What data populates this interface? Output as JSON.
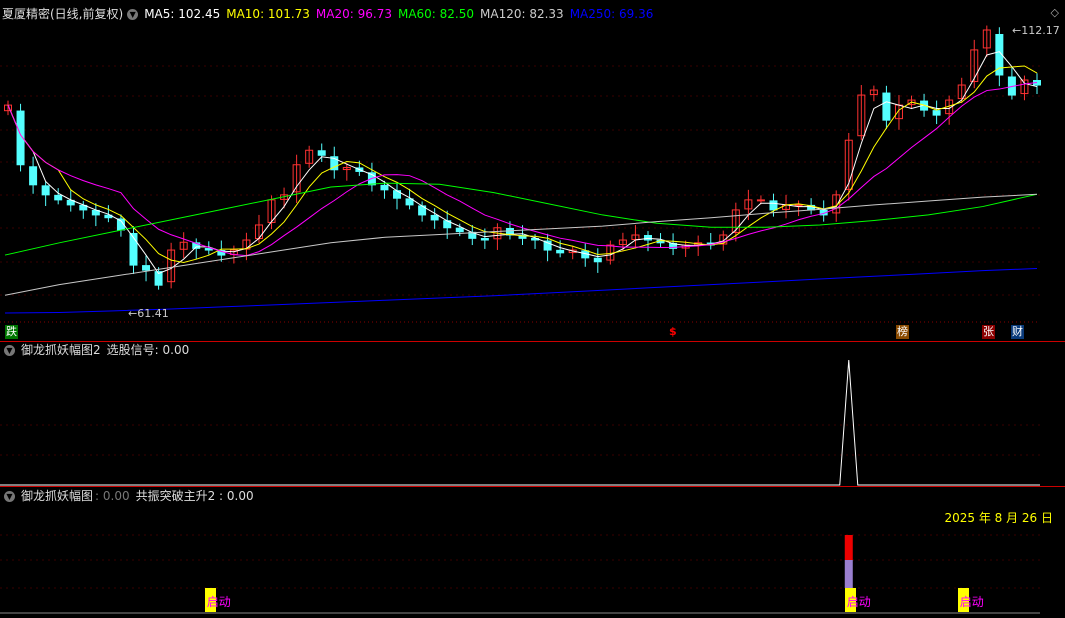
{
  "main": {
    "title": "夏厦精密(日线,前复权)",
    "ma": [
      {
        "label": "MA5: 102.45",
        "color": "#ffffff"
      },
      {
        "label": "MA10: 101.73",
        "color": "#ffff00"
      },
      {
        "label": "MA20: 96.73",
        "color": "#ff00ff"
      },
      {
        "label": "MA60: 82.50",
        "color": "#00ff00"
      },
      {
        "label": "MA120: 82.33",
        "color": "#cccccc"
      },
      {
        "label": "MA250: 69.36",
        "color": "#0000ff"
      }
    ],
    "high_label": "112.17",
    "low_label": "61.41",
    "markers": [
      {
        "text": "跌",
        "bg": "#007700"
      },
      {
        "text": "$",
        "bg": "transparent"
      },
      {
        "text": "榜",
        "bg": "#8a4a00"
      },
      {
        "text": "张",
        "bg": "#8a0000"
      },
      {
        "text": "财",
        "bg": "#0a3a7a"
      }
    ]
  },
  "panel1": {
    "title": "御龙抓妖幅图2",
    "signal": "选股信号: 0.00"
  },
  "panel2": {
    "title": "御龙抓妖幅图",
    "v1": ": 0.00",
    "v2": "共振突破主升2 : 0.00",
    "date": "2025 年 8 月 26 日",
    "tag": "启动"
  },
  "chart_data": {
    "type": "candlestick",
    "ylim": [
      61.41,
      112.17
    ],
    "closes": [
      98.7,
      88,
      84.4,
      82.6,
      81.7,
      80.8,
      79.9,
      79,
      78.5,
      76.3,
      70,
      69.1,
      66.4,
      72.7,
      74.1,
      73,
      72.7,
      71.8,
      72.7,
      74.5,
      77.2,
      81.7,
      82.6,
      88,
      90.6,
      89.7,
      87.1,
      87.5,
      86.8,
      84.4,
      83.5,
      82,
      80.8,
      79,
      78.1,
      76.7,
      76,
      74.8,
      74.5,
      76.7,
      75.4,
      74.8,
      74.5,
      72.7,
      72.2,
      72.7,
      71.3,
      70.6,
      73.6,
      74.5,
      75.4,
      74.5,
      74,
      73,
      73.6,
      74,
      73.6,
      75.4,
      79.9,
      81.7,
      81.7,
      79.9,
      80.8,
      80.8,
      79.9,
      79,
      82.6,
      92.4,
      100.5,
      101.4,
      96,
      98.7,
      99.6,
      97.8,
      96.9,
      99.6,
      102.3,
      108.6,
      112.17,
      104.1,
      100.5,
      103.2,
      102.3
    ],
    "ma60": [
      71.8,
      74,
      76,
      78,
      80,
      82,
      84,
      84.7,
      84.5,
      83,
      81,
      79,
      77.5,
      76.8,
      76.8,
      77.2,
      78,
      79,
      80.5,
      82.7
    ],
    "ma120": [
      64.6,
      66.5,
      68,
      69.5,
      71,
      72.5,
      74,
      75,
      75.5,
      76,
      76.5,
      77,
      77.8,
      78.5,
      79.3,
      80,
      80.8,
      81.5,
      82.2,
      82.7
    ],
    "ma250": [
      61.41,
      61.5,
      61.8,
      62.1,
      62.5,
      62.9,
      63.3,
      63.7,
      64.1,
      64.5,
      65,
      65.5,
      66,
      66.5,
      67,
      67.5,
      68,
      68.5,
      69,
      69.4
    ],
    "signal_spike_index": 67,
    "qidong_indices": [
      16,
      67,
      76
    ]
  }
}
